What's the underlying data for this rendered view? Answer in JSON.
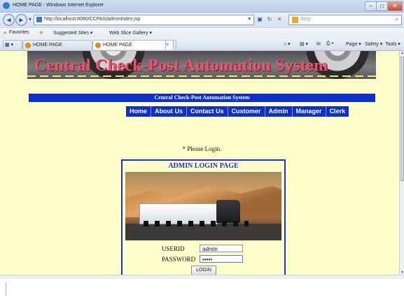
{
  "browser": {
    "window_title": "HOME PAGE - Windows Internet Explorer",
    "url": "http://localhost:8080/CCPAS/adminIndex.jsp",
    "search_placeholder": "Bing",
    "favorites_label": "Favorites",
    "fav_links": [
      "Suggested Sites ▾",
      "Web Slice Gallery ▾"
    ],
    "tabs": [
      {
        "label": "HOME PAGE",
        "active": false
      },
      {
        "label": "HOME PAGE",
        "active": true
      }
    ],
    "commands": [
      "Page ▾",
      "Safety ▾",
      "Tools ▾"
    ]
  },
  "page": {
    "banner_title": "Central Check-Post Automation System",
    "subtitle": "Central Check-Post Automation System",
    "menu": [
      "Home",
      "About Us",
      "Contact Us",
      "Customer",
      "Admin",
      "Manager",
      "Clerk"
    ],
    "notice": "* Please Login.",
    "login": {
      "heading": "ADMIN LOGIN PAGE",
      "userid_label": "USERID",
      "userid_value": "admin",
      "password_label": "PASSWORD",
      "password_value": "•••••",
      "button_label": "LOGIN"
    }
  },
  "colors": {
    "page_bg": "#ffffcc",
    "nav_blue": "#0e2fc8",
    "banner_text": "#e8566b"
  }
}
